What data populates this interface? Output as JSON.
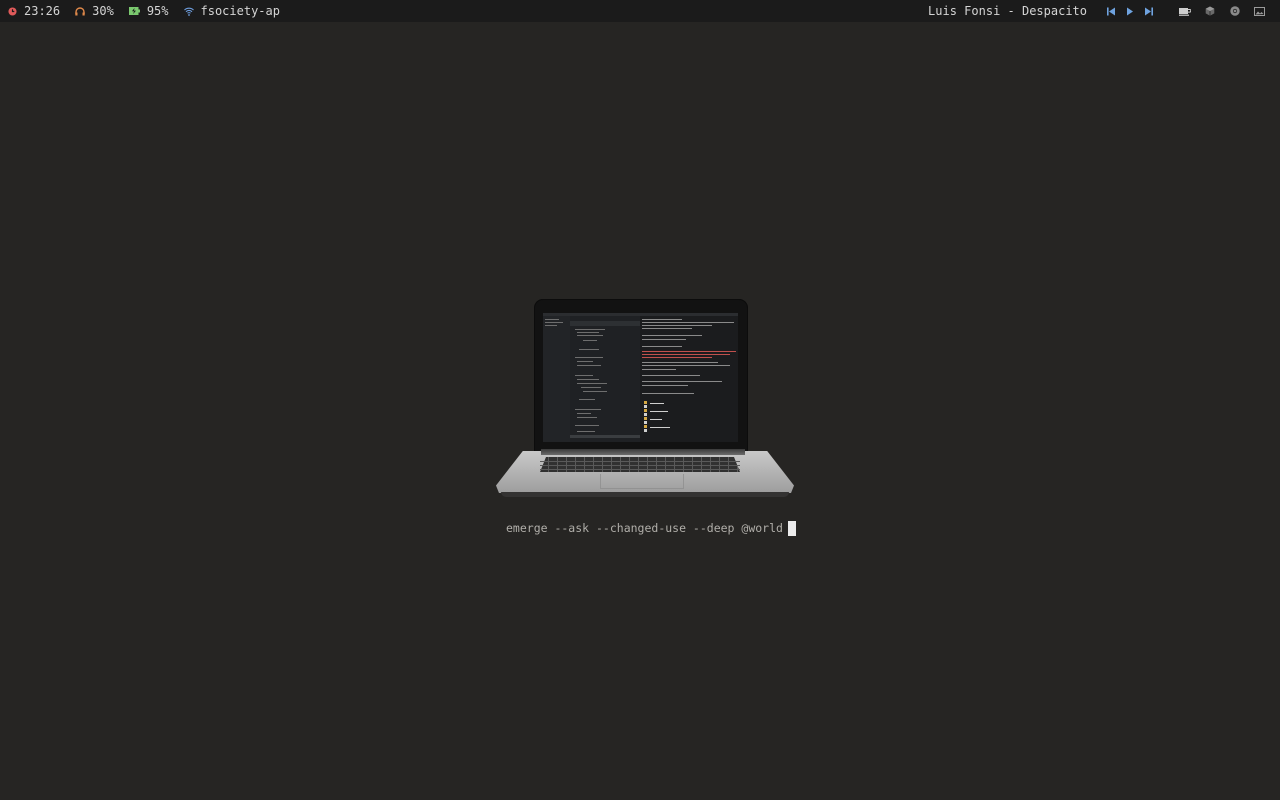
{
  "statusbar": {
    "clock": "23:26",
    "volume": "30%",
    "battery": "95%",
    "wifi": "fsociety-ap",
    "now_playing": "Luis Fonsi - Despacito"
  },
  "icons": {
    "clock": "clock-icon",
    "volume": "headphones-icon",
    "battery": "battery-charging-icon",
    "wifi": "wifi-icon",
    "prev": "skip-previous-icon",
    "play": "play-icon",
    "next": "skip-next-icon",
    "tray": [
      "coffee-icon",
      "cube-icon",
      "chrome-icon",
      "image-icon"
    ]
  },
  "colors": {
    "background": "#262523",
    "bar": "#1b1b1b",
    "clock_icon": "#e05a5a",
    "volume_icon": "#e0894a",
    "battery_icon": "#7bc96f",
    "wifi_icon": "#6f9fe0",
    "media_icon": "#6fa3e0"
  },
  "terminal": {
    "command": "emerge --ask --changed-use --deep @world"
  }
}
